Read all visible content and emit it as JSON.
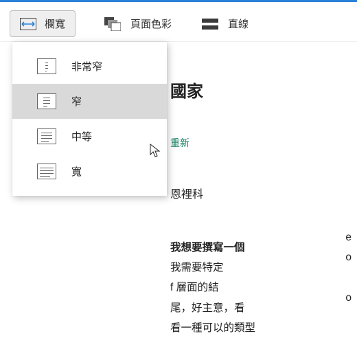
{
  "toolbar": {
    "column_width": {
      "label": "欄寬"
    },
    "page_color": {
      "label": "頁面色彩"
    },
    "line": {
      "label": "直線"
    }
  },
  "dropdown": {
    "items": [
      {
        "label": "非常窄"
      },
      {
        "label": "窄"
      },
      {
        "label": "中等"
      },
      {
        "label": "寬"
      }
    ]
  },
  "page": {
    "title_fragment": "國家",
    "edit_fragment": "重新",
    "name": "恩裡科",
    "body_bold": "我想要撰寫一個",
    "body_lines": [
      "我需要特定",
      "f 層面的結",
      "尾，好主意，看",
      "看一種可以的類型"
    ],
    "right_col": [
      "e",
      "o",
      "",
      "o"
    ]
  }
}
